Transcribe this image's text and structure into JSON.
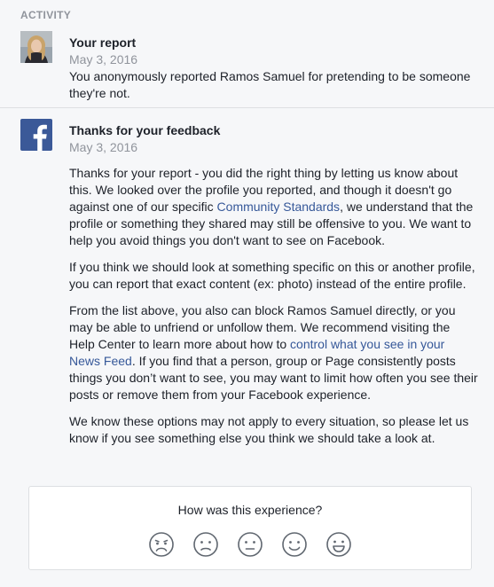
{
  "section_label": "ACTIVITY",
  "report": {
    "title": "Your report",
    "date": "May 3, 2016",
    "text": "You anonymously reported Ramos Samuel for pretending to be someone they're not."
  },
  "feedback_entry": {
    "title": "Thanks for your feedback",
    "date": "May 3, 2016",
    "p1_before": "Thanks for your report - you did the right thing by letting us know about this. We looked over the profile you reported, and though it doesn't go against one of our specific ",
    "p1_link": "Community Standards",
    "p1_after": ", we understand that the profile or something they shared may still be offensive to you. We want to help you avoid things you don't want to see on Facebook.",
    "p2": "If you think we should look at something specific on this or another profile, you can report that exact content (ex: photo) instead of the entire profile.",
    "p3_before": "From the list above, you also can block Ramos Samuel directly, or you may be able to unfriend or unfollow them. We recommend visiting the Help Center to learn more about how to ",
    "p3_link": "control what you see in your News Feed",
    "p3_after": ". If you find that a person, group or Page consistently posts things you don’t want to see, you may want to limit how often you see their posts or remove them from your Facebook experience.",
    "p4": "We know these options may not apply to every situation, so please let us know if you see something else you think we should take a look at."
  },
  "survey": {
    "question": "How was this experience?",
    "faces": [
      "very-sad-face-icon",
      "sad-face-icon",
      "neutral-face-icon",
      "smile-face-icon",
      "big-smile-face-icon"
    ]
  },
  "colors": {
    "link": "#365899",
    "facebook_blue": "#3b5998",
    "muted": "#90949c"
  }
}
